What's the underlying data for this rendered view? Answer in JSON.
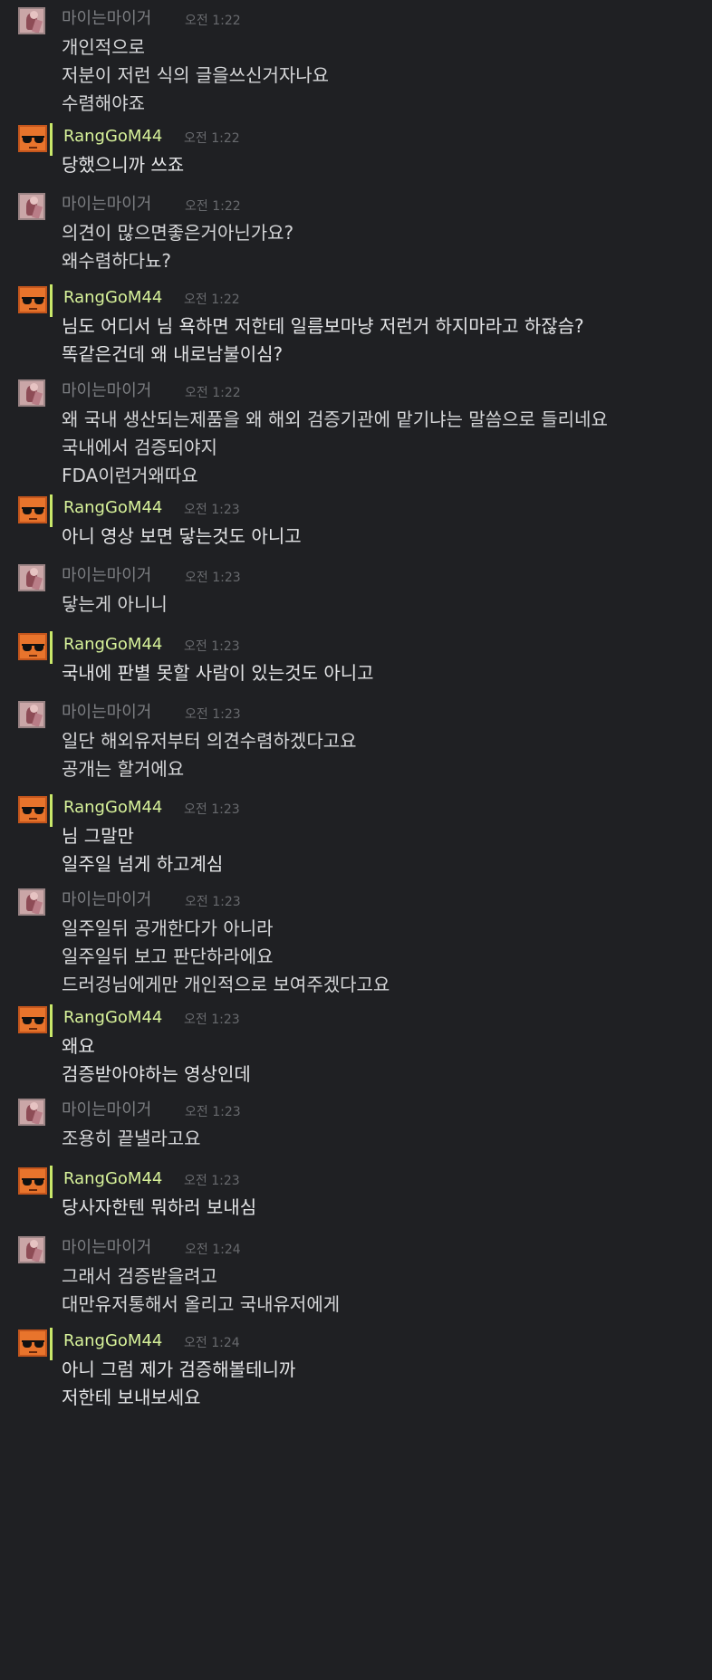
{
  "colors": {
    "background": "#1f2023",
    "name_user_a": "#7c7e82",
    "name_user_b": "#d7f29a",
    "accent_bar_b": "#c9e86a",
    "timestamp": "#686a6e",
    "message_text": "#d5d6d8"
  },
  "messages": [
    {
      "author": "마이는마이거",
      "time": "오전 1:22",
      "lines": [
        "개인적으로",
        "저분이 저런 식의 글을쓰신거자나요",
        "수렴해야죠"
      ]
    },
    {
      "author": "RangGoM44",
      "time": "오전 1:22",
      "lines": [
        "당했으니까 쓰죠"
      ]
    },
    {
      "author": "마이는마이거",
      "time": "오전 1:22",
      "lines": [
        "의견이 많으면좋은거아닌가요?",
        "왜수렴하다뇨?"
      ]
    },
    {
      "author": "RangGoM44",
      "time": "오전 1:22",
      "lines": [
        "님도 어디서 님 욕하면 저한테 일름보마냥 저런거 하지마라고 하잖슴?",
        "똑같은건데 왜 내로남불이심?"
      ]
    },
    {
      "author": "마이는마이거",
      "time": "오전 1:22",
      "lines": [
        "왜 국내 생산되는제품을 왜 해외 검증기관에 맡기냐는 말씀으로 들리네요",
        "국내에서 검증되야지",
        "FDA이런거왜따요"
      ]
    },
    {
      "author": "RangGoM44",
      "time": "오전 1:23",
      "lines": [
        "아니 영상 보면 닿는것도 아니고"
      ]
    },
    {
      "author": "마이는마이거",
      "time": "오전 1:23",
      "lines": [
        "닿는게 아니니"
      ]
    },
    {
      "author": "RangGoM44",
      "time": "오전 1:23",
      "lines": [
        "국내에 판별 못할 사람이 있는것도 아니고"
      ]
    },
    {
      "author": "마이는마이거",
      "time": "오전 1:23",
      "lines": [
        "일단 해외유저부터 의견수렴하겠다고요",
        "공개는 할거에요"
      ]
    },
    {
      "author": "RangGoM44",
      "time": "오전 1:23",
      "lines": [
        "님 그말만",
        "일주일 넘게 하고계심"
      ]
    },
    {
      "author": "마이는마이거",
      "time": "오전 1:23",
      "lines": [
        "일주일뒤 공개한다가 아니라",
        "일주일뒤 보고 판단하라에요",
        "드러겅님에게만 개인적으로 보여주겠다고요"
      ]
    },
    {
      "author": "RangGoM44",
      "time": "오전 1:23",
      "lines": [
        "왜요",
        "검증받아야하는 영상인데"
      ]
    },
    {
      "author": "마이는마이거",
      "time": "오전 1:23",
      "lines": [
        "조용히 끝낼라고요"
      ]
    },
    {
      "author": "RangGoM44",
      "time": "오전 1:23",
      "lines": [
        "당사자한텐 뭐하러 보내심"
      ]
    },
    {
      "author": "마이는마이거",
      "time": "오전 1:24",
      "lines": [
        "그래서 검증받을려고",
        "대만유저통해서 올리고 국내유저에게"
      ]
    },
    {
      "author": "RangGoM44",
      "time": "오전 1:24",
      "lines": [
        "아니 그럼 제가 검증해볼테니까",
        "저한테 보내보세요"
      ]
    }
  ]
}
